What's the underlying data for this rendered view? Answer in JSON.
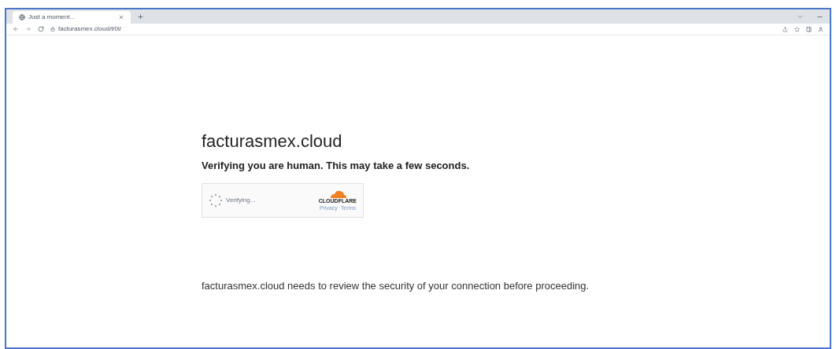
{
  "tabs": [
    {
      "title": "Just a moment...",
      "selected": true
    }
  ],
  "address_bar": {
    "url": "facturasmex.cloud/t/0l/"
  },
  "page": {
    "site": "facturasmex.cloud",
    "subtitle": "Verifying you are human. This may take a few seconds.",
    "widget": {
      "status": "Verifying...",
      "brand": "CLOUDFLARE",
      "links": [
        "Privacy",
        "Terms"
      ]
    },
    "message": "facturasmex.cloud needs to review the security of your connection before proceeding."
  }
}
